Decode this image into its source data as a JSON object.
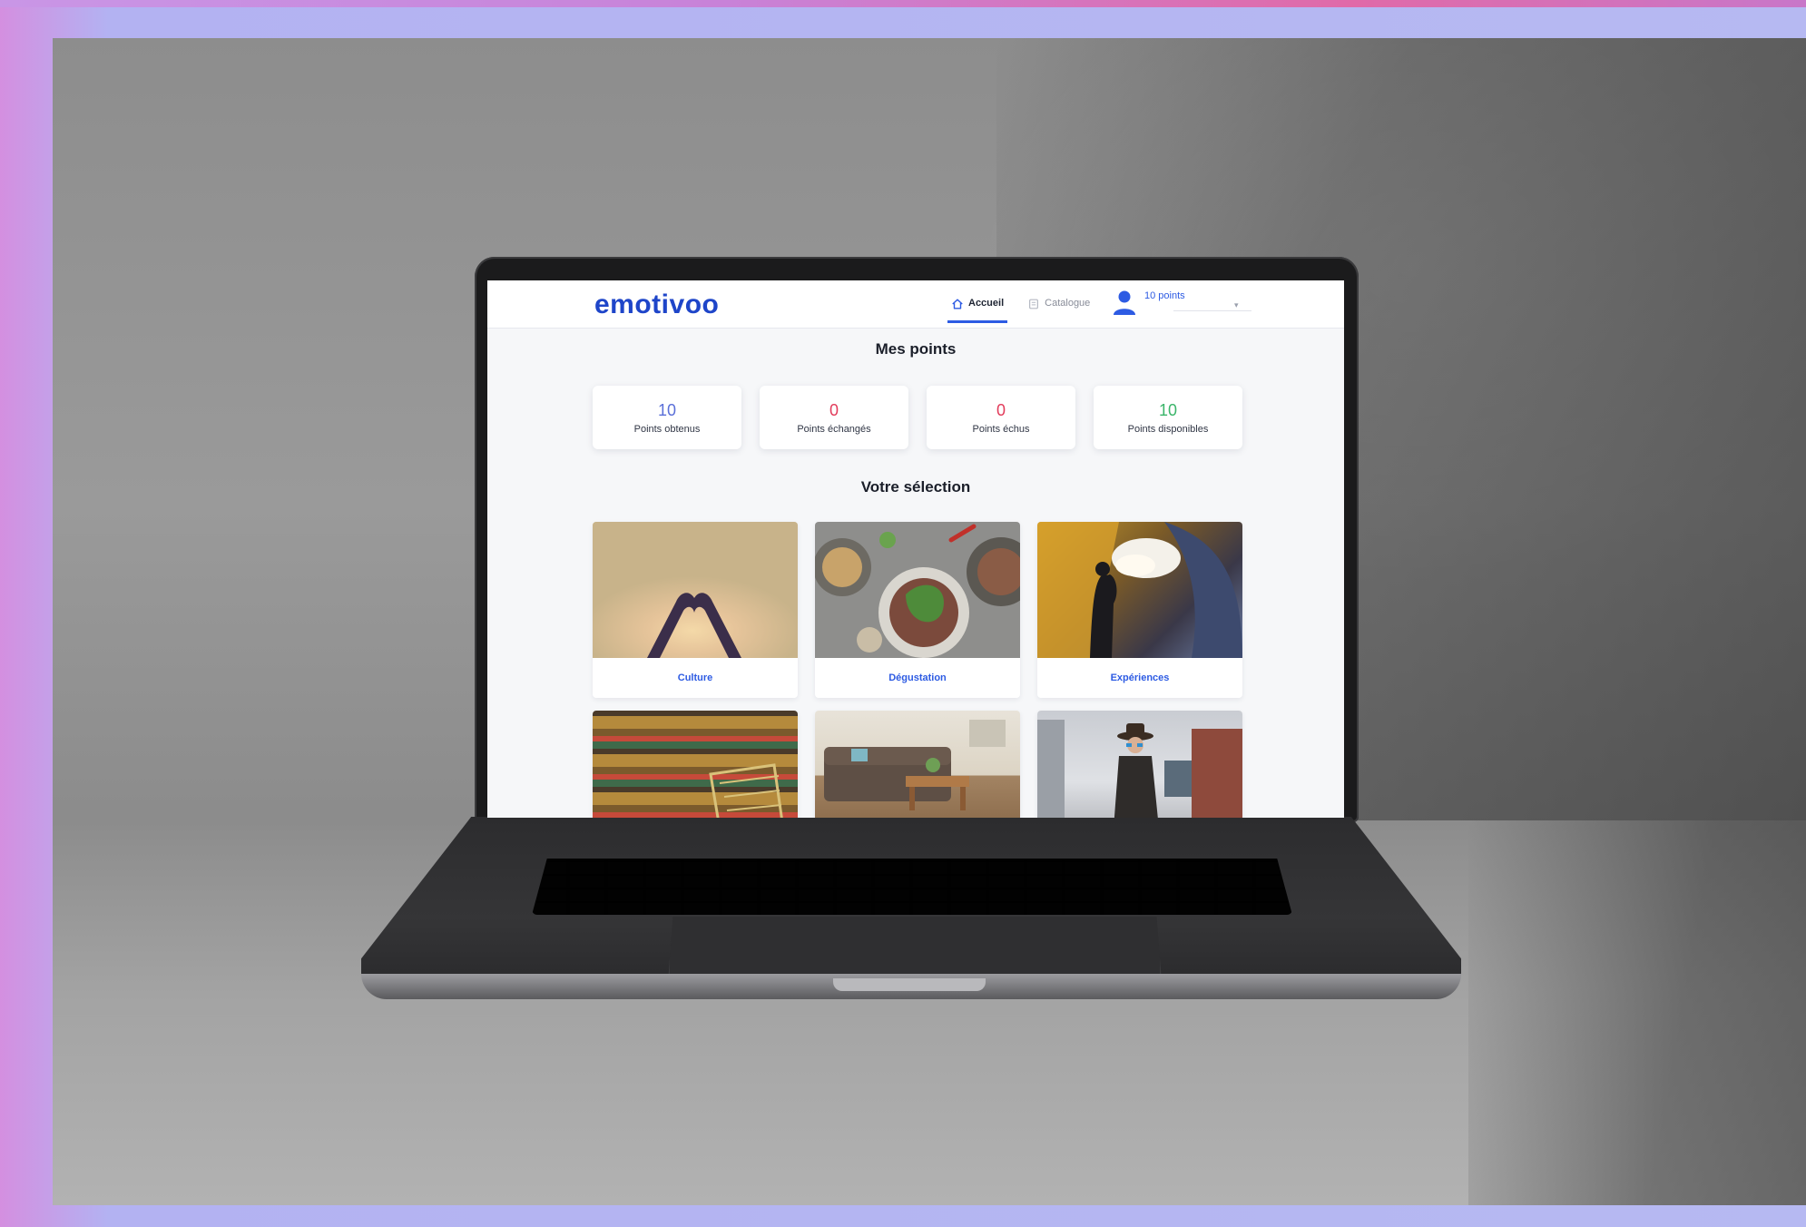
{
  "app": {
    "logo": "emotivoo",
    "nav": [
      {
        "label": "Accueil",
        "icon": "home-icon",
        "active": true
      },
      {
        "label": "Catalogue",
        "icon": "catalog-icon",
        "active": false
      }
    ],
    "user": {
      "points_label": "10 points",
      "icon": "user-avatar-icon"
    },
    "accent_color": "#2d5be3"
  },
  "points": {
    "title": "Mes points",
    "stats": [
      {
        "value": "10",
        "label": "Points obtenus",
        "color": "#5a6fd8"
      },
      {
        "value": "0",
        "label": "Points échangés",
        "color": "#e23b5a"
      },
      {
        "value": "0",
        "label": "Points échus",
        "color": "#e23b5a"
      },
      {
        "value": "10",
        "label": "Points disponibles",
        "color": "#3bb56a"
      }
    ]
  },
  "selection": {
    "title": "Votre sélection",
    "categories": [
      {
        "label": "Culture",
        "image": "heart-hands-photo"
      },
      {
        "label": "Dégustation",
        "image": "food-plates-photo"
      },
      {
        "label": "Expériences",
        "image": "hot-air-balloon-photo"
      },
      {
        "label": "",
        "image": "grocery-shelves-photo"
      },
      {
        "label": "",
        "image": "living-room-photo"
      },
      {
        "label": "",
        "image": "woman-street-photo"
      }
    ]
  }
}
